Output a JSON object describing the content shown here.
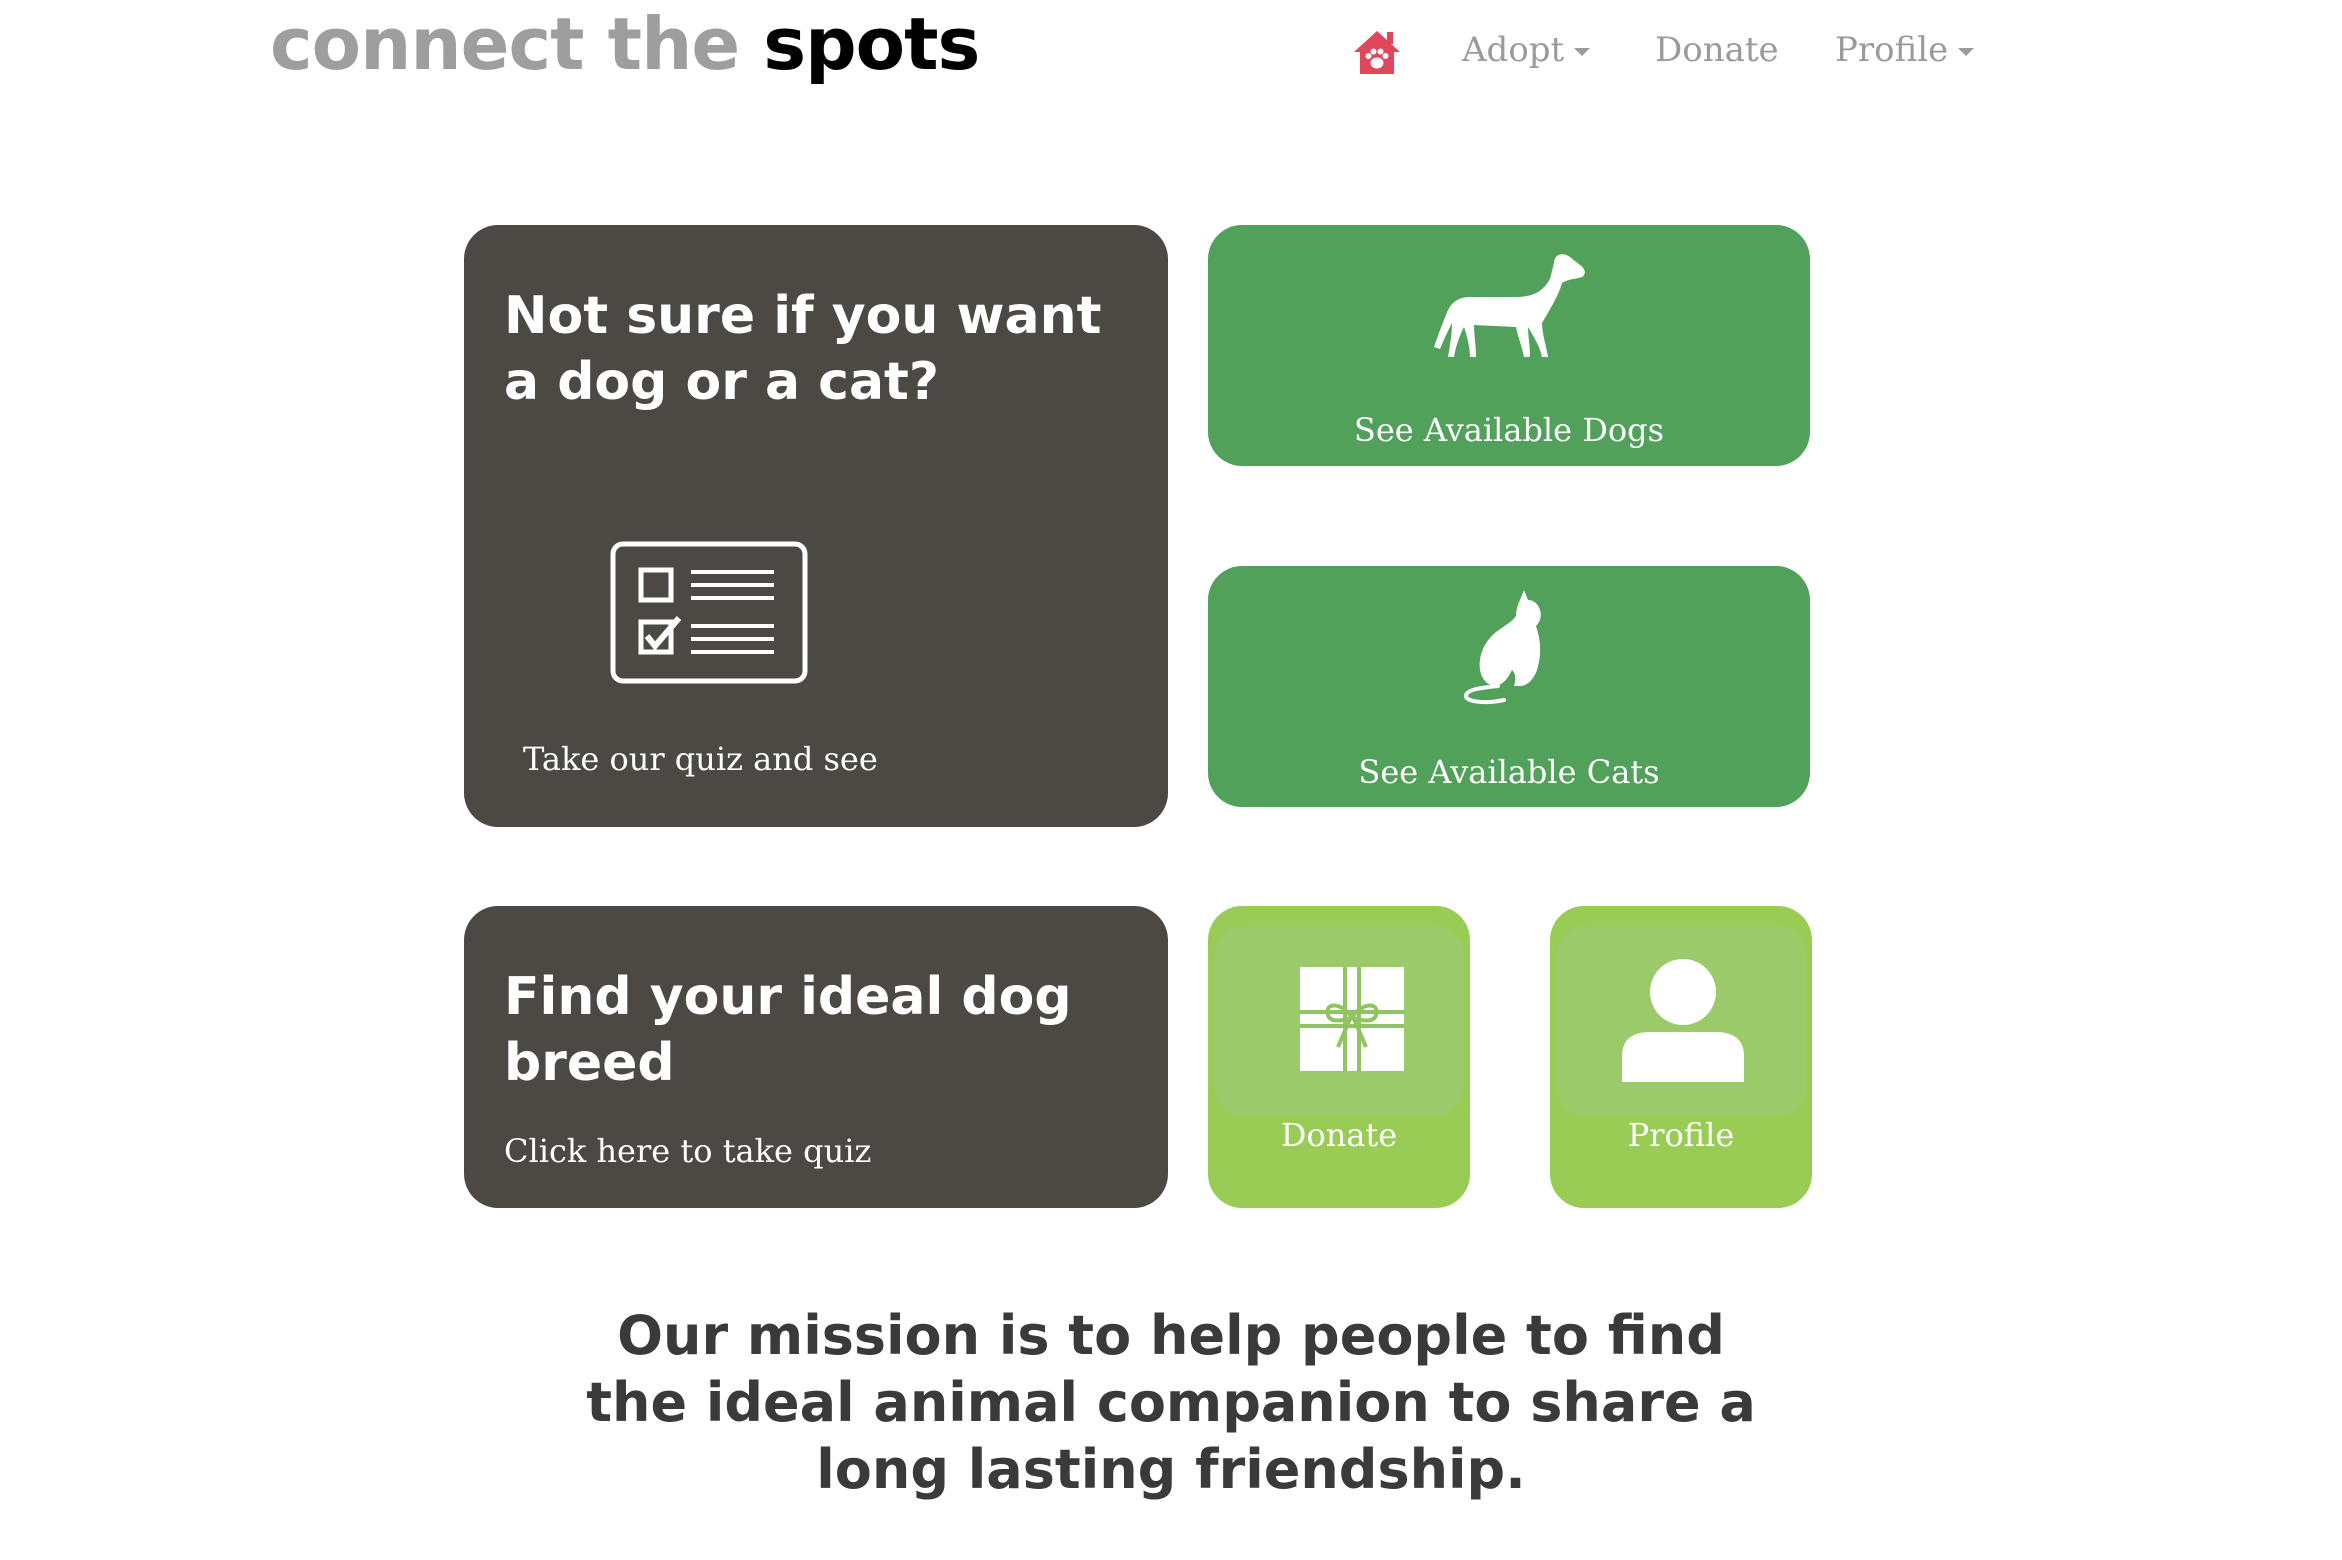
{
  "header": {
    "logo_part1": "connect the",
    "logo_part2": "spots",
    "nav": {
      "home_icon": "house-paw-icon",
      "adopt": "Adopt",
      "donate": "Donate",
      "profile": "Profile"
    }
  },
  "cards": {
    "quiz": {
      "title": "Not sure if you want a dog or a cat?",
      "subtitle": "Take our quiz and see",
      "icon": "checklist-icon"
    },
    "dogs": {
      "label": "See Available Dogs",
      "icon": "dog-icon"
    },
    "cats": {
      "label": "See Available Cats",
      "icon": "cat-icon"
    },
    "breed": {
      "title": "Find your ideal dog breed",
      "subtitle": "Click here to take quiz"
    },
    "donate": {
      "label": "Donate",
      "icon": "gift-icon"
    },
    "profile": {
      "label": "Profile",
      "icon": "user-icon"
    }
  },
  "mission": "Our mission is to help people to find the ideal animal companion to share a long lasting friendship.",
  "colors": {
    "dark_card": "#4c4945",
    "green_card": "#51a15a",
    "lime_card": "#98cc55",
    "home_icon": "#e0475b",
    "nav_text": "#9a9a9a"
  }
}
